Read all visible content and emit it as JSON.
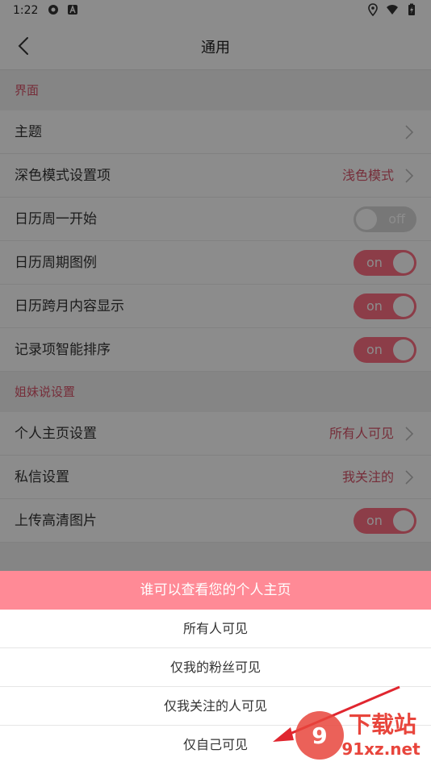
{
  "status_bar": {
    "time": "1:22"
  },
  "nav": {
    "title": "通用"
  },
  "sections": [
    {
      "header": "界面",
      "rows": [
        {
          "label": "主题",
          "kind": "chevron",
          "value": ""
        },
        {
          "label": "深色模式设置项",
          "kind": "chevron",
          "value": "浅色模式"
        },
        {
          "label": "日历周一开始",
          "kind": "toggle",
          "state": "off"
        },
        {
          "label": "日历周期图例",
          "kind": "toggle",
          "state": "on"
        },
        {
          "label": "日历跨月内容显示",
          "kind": "toggle",
          "state": "on"
        },
        {
          "label": "记录项智能排序",
          "kind": "toggle",
          "state": "on"
        }
      ]
    },
    {
      "header": "姐妹说设置",
      "rows": [
        {
          "label": "个人主页设置",
          "kind": "chevron",
          "value": "所有人可见"
        },
        {
          "label": "私信设置",
          "kind": "chevron",
          "value": "我关注的"
        },
        {
          "label": "上传高清图片",
          "kind": "toggle",
          "state": "on"
        }
      ]
    }
  ],
  "sheet": {
    "title": "谁可以查看您的个人主页",
    "options": [
      "所有人可见",
      "仅我的粉丝可见",
      "仅我关注的人可见",
      "仅自己可见"
    ]
  },
  "watermark": {
    "brand": "下载站",
    "domain": "91xz.net"
  },
  "colors": {
    "accent": "#d8546a",
    "toggle_on": "#ff6f84",
    "sheet_title_bg": "#ff8a96"
  }
}
